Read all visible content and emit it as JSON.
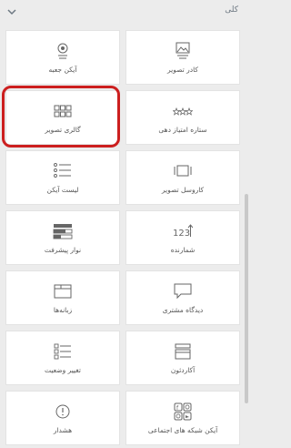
{
  "header": {
    "title": "کلی",
    "collapse_icon": "chevron-down-icon"
  },
  "widgets": [
    {
      "id": "icon-box",
      "label": "آیکن جعبه",
      "icon": "icon-box-icon"
    },
    {
      "id": "image-box",
      "label": "کادر تصویر",
      "icon": "image-box-icon"
    },
    {
      "id": "image-gallery",
      "label": "گالری تصویر",
      "icon": "gallery-grid-icon"
    },
    {
      "id": "star-rating",
      "label": "ستاره امتیاز دهی",
      "icon": "star-rating-icon"
    },
    {
      "id": "icon-list",
      "label": "لیست آیکن",
      "icon": "icon-list-icon"
    },
    {
      "id": "image-carousel",
      "label": "کاروسل تصویر",
      "icon": "carousel-icon"
    },
    {
      "id": "progress-bar",
      "label": "نوار پیشرفت",
      "icon": "progress-bar-icon"
    },
    {
      "id": "counter",
      "label": "شمارنده",
      "icon": "counter-icon"
    },
    {
      "id": "tabs",
      "label": "زبانه‌ها",
      "icon": "tabs-icon"
    },
    {
      "id": "testimonial",
      "label": "دیدگاه مشتری",
      "icon": "testimonial-icon"
    },
    {
      "id": "toggle",
      "label": "تغییر وضعیت",
      "icon": "toggle-icon"
    },
    {
      "id": "accordion",
      "label": "آکاردئون",
      "icon": "accordion-icon"
    },
    {
      "id": "alert",
      "label": "هشدار",
      "icon": "alert-icon"
    },
    {
      "id": "social-icons",
      "label": "آیکن شبکه های اجتماعی",
      "icon": "social-icons-icon"
    }
  ],
  "highlighted_widget": "image-gallery",
  "colors": {
    "highlight": "#cc1f1f",
    "icon": "#666666"
  }
}
